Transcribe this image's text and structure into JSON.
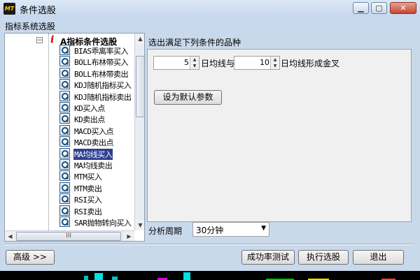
{
  "window": {
    "title": "条件选股",
    "app_icon": "MT"
  },
  "left": {
    "heading": "指标系统选股",
    "tree": {
      "root_label": "A指标条件选股",
      "items": [
        "BIAS乖离率买入",
        "BOLL布林带买入",
        "BOLL布林带卖出",
        "KDJ随机指标买入",
        "KDJ随机指标卖出",
        "KD买入点",
        "KD卖出点",
        "MACD买入点",
        "MACD卖出点",
        "MA均线买入",
        "MA均线卖出",
        "MTM买入",
        "MTM卖出",
        "RSI买入",
        "RSI卖出",
        "SAR抛物转向买入"
      ],
      "selected_index": 9,
      "scroll_middle": "III"
    }
  },
  "right": {
    "heading": "选出满足下列条件的品种",
    "param1": "5",
    "text1": "日均线与",
    "param2": "10",
    "text2": "日均线形成金叉",
    "default_button": "设为默认参数",
    "period_label": "分析周期",
    "period_value": "30分钟"
  },
  "footer": {
    "advanced": "高级 >>",
    "test": "成功率测试",
    "execute": "执行选股",
    "exit": "退出"
  },
  "colors": {
    "selection": "#2f3f8f",
    "accent_red": "#d00000",
    "title_bg": "#c9d9ec"
  }
}
